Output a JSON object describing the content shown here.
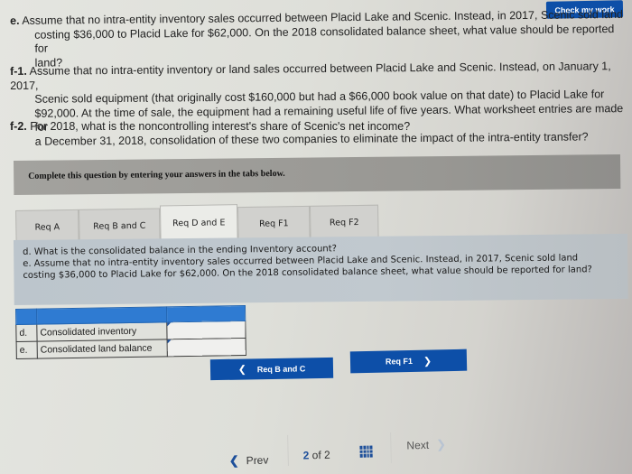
{
  "header": {
    "check_my_work": "Check my work"
  },
  "questions": {
    "e": {
      "label": "e.",
      "text_line1": "Assume that no intra-entity inventory sales occurred between Placid Lake and Scenic. Instead, in 2017, Scenic sold land",
      "text_line2": "costing $36,000 to Placid Lake for $62,000. On the 2018 consolidated balance sheet, what value should be reported for",
      "text_line3": "land?"
    },
    "f1": {
      "label": "f-1.",
      "text_line1": "Assume that no intra-entity inventory or land sales occurred between Placid Lake and Scenic. Instead, on January 1, 2017,",
      "text_line2": "Scenic sold equipment (that originally cost $160,000 but had a $66,000 book value on that date) to Placid Lake for",
      "text_line3": "$92,000. At the time of sale, the equipment had a remaining useful life of five years. What worksheet entries are made for",
      "text_line4": "a December 31, 2018, consolidation of these two companies to eliminate the impact of the intra-entity transfer?"
    },
    "f2": {
      "label": "f-2.",
      "text": "For 2018, what is the noncontrolling interest's share of Scenic's net income?"
    }
  },
  "instructions": "Complete this question by entering your answers in the tabs below.",
  "tabs": [
    {
      "label": "Req A",
      "active": false
    },
    {
      "label": "Req B and C",
      "active": false
    },
    {
      "label": "Req D and E",
      "active": true
    },
    {
      "label": "Req F1",
      "active": false
    },
    {
      "label": "Req F2",
      "active": false
    }
  ],
  "panel": {
    "line1": "d. What is the consolidated balance in the ending Inventory account?",
    "line2": "e. Assume that no intra-entity inventory sales occurred between Placid Lake and Scenic. Instead, in 2017, Scenic sold land",
    "line3": "costing $36,000 to Placid Lake for $62,000. On the 2018 consolidated balance sheet, what value should be reported for land?"
  },
  "answer_table": {
    "rows": [
      {
        "letter": "d.",
        "label": "Consolidated inventory",
        "value": ""
      },
      {
        "letter": "e.",
        "label": "Consolidated land balance",
        "value": ""
      }
    ]
  },
  "nav": {
    "prev_label": "Req B and C",
    "next_label": "Req F1"
  },
  "footer": {
    "prev": "Prev",
    "current_page": "2",
    "of_text": "of",
    "total_pages": "2",
    "next": "Next"
  }
}
